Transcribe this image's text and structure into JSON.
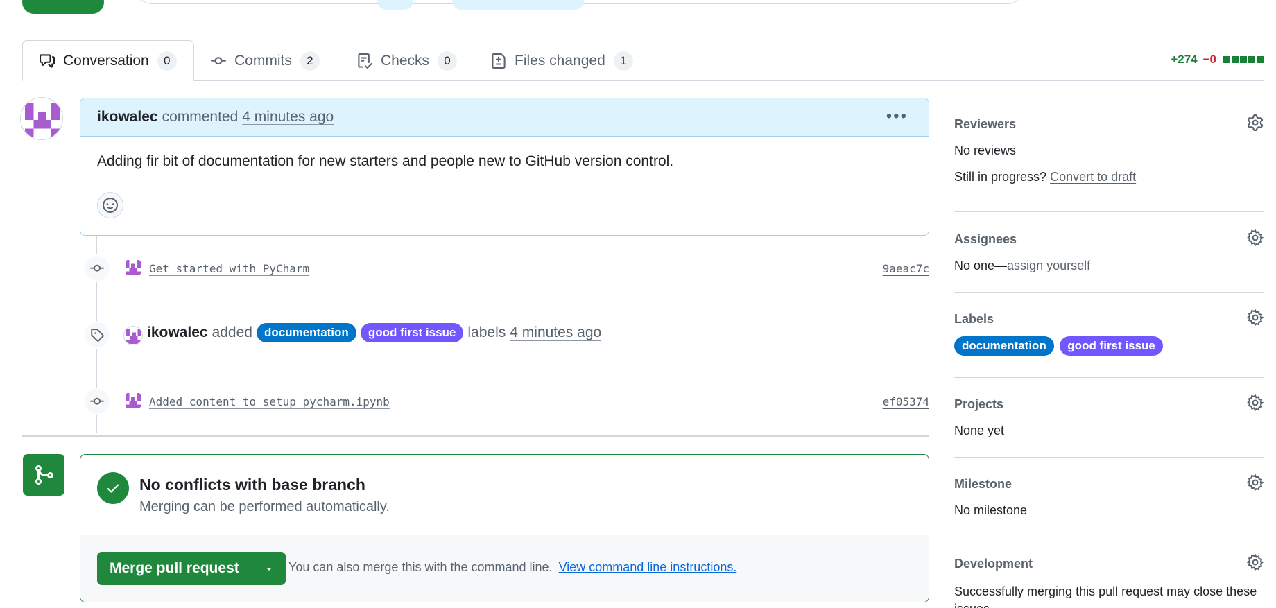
{
  "tabs": [
    {
      "label": "Conversation",
      "count": "0",
      "icon": "comment-discussion-icon"
    },
    {
      "label": "Commits",
      "count": "2",
      "icon": "git-commit-icon"
    },
    {
      "label": "Checks",
      "count": "0",
      "icon": "checklist-icon"
    },
    {
      "label": "Files changed",
      "count": "1",
      "icon": "file-diff-icon"
    }
  ],
  "diffstat": {
    "additions": "+274",
    "deletions": "−0"
  },
  "comment": {
    "author": "ikowalec",
    "action": "commented",
    "time": "4 minutes ago",
    "body": "Adding fir bit of documentation for new starters and people new to GitHub version control."
  },
  "timeline": {
    "commit1": {
      "message": "Get started with PyCharm",
      "sha": "9aeac7c"
    },
    "label_event": {
      "actor": "ikowalec",
      "verb": "added",
      "labels": [
        "documentation",
        "good first issue"
      ],
      "suffix": "labels",
      "time": "4 minutes ago"
    },
    "commit2": {
      "message": "Added content to setup_pycharm.ipynb",
      "sha": "ef05374"
    }
  },
  "merge": {
    "title": "No conflicts with base branch",
    "subtitle": "Merging can be performed automatically.",
    "button": "Merge pull request",
    "note": "You can also merge this with the command line.",
    "link": "View command line instructions."
  },
  "sidebar": {
    "reviewers": {
      "heading": "Reviewers",
      "text": "No reviews",
      "progress_prefix": "Still in progress?",
      "progress_link": "Convert to draft"
    },
    "assignees": {
      "heading": "Assignees",
      "prefix": "No one—",
      "link": "assign yourself"
    },
    "labels": {
      "heading": "Labels",
      "items": [
        "documentation",
        "good first issue"
      ]
    },
    "projects": {
      "heading": "Projects",
      "text": "None yet"
    },
    "milestone": {
      "heading": "Milestone",
      "text": "No milestone"
    },
    "development": {
      "heading": "Development",
      "text": "Successfully merging this pull request may close these issues."
    }
  },
  "colors": {
    "documentation": "#0075ca",
    "good_first_issue": "#7057ff",
    "merge_green": "#1f883d",
    "comment_header": "#ddf4ff"
  }
}
